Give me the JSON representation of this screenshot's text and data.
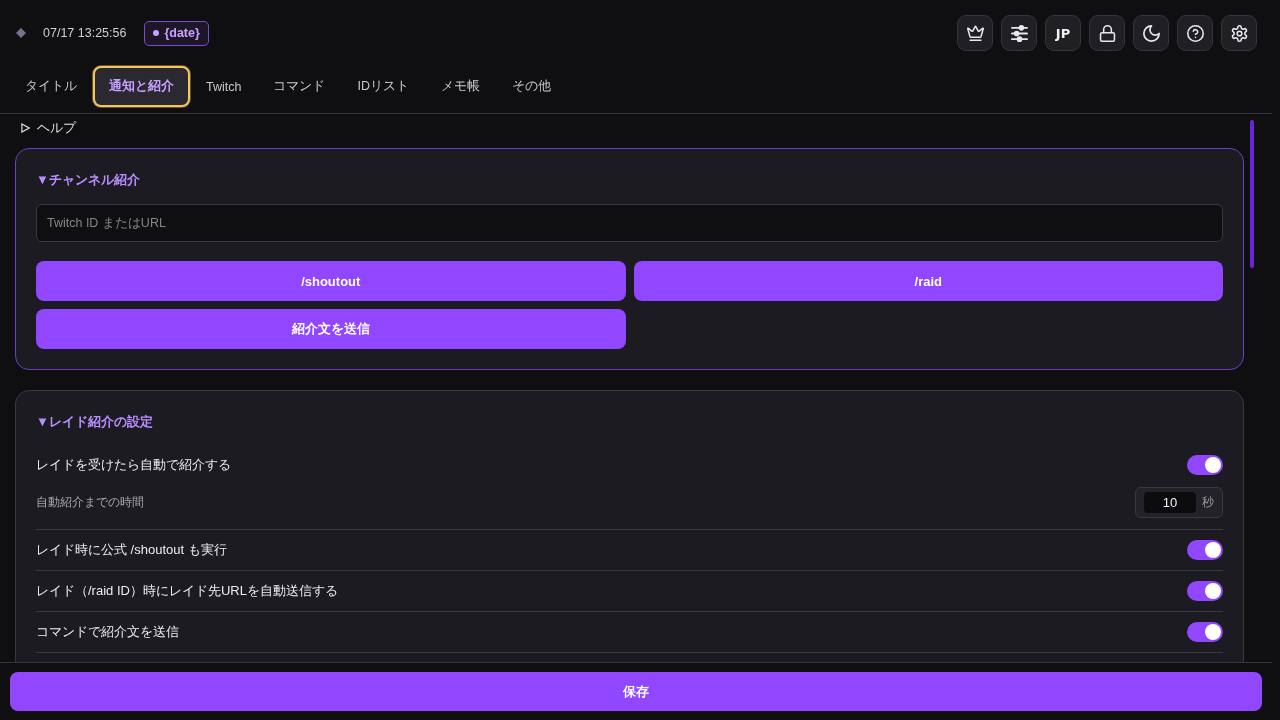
{
  "header": {
    "time": "07/17 13:25:56",
    "badge": {
      "label": "{date}"
    },
    "language_button": {
      "label": "JP"
    }
  },
  "tabs": [
    {
      "label": "タイトル",
      "selected": false
    },
    {
      "label": "通知と紹介",
      "selected": true
    },
    {
      "label": "Twitch",
      "selected": false
    },
    {
      "label": "コマンド",
      "selected": false
    },
    {
      "label": "IDリスト",
      "selected": false
    },
    {
      "label": "メモ帳",
      "selected": false
    },
    {
      "label": "その他",
      "selected": false
    }
  ],
  "help": {
    "label": "ヘルプ",
    "expanded": false
  },
  "channel_intro": {
    "title": "▼チャンネル紹介",
    "input": {
      "placeholder": "Twitch ID またはURL"
    },
    "buttons": [
      "/shoutout",
      "/raid",
      "紹介文を送信"
    ]
  },
  "raid_settings": {
    "title": "▼レイド紹介の設定",
    "rows": [
      {
        "kind": "toggle",
        "label": "レイドを受けたら自動で紹介する",
        "on": true
      },
      {
        "kind": "number",
        "label": "自動紹介までの時間",
        "value": "10",
        "unit": "秒"
      },
      {
        "kind": "toggle",
        "label": "レイド時に公式 /shoutout も実行",
        "on": true
      },
      {
        "kind": "toggle",
        "label": "レイド（/raid ID）時にレイド先URLを自動送信する",
        "on": true
      },
      {
        "kind": "toggle",
        "label": "コマンドで紹介文を送信",
        "on": true
      }
    ]
  },
  "save_button": {
    "label": "保存"
  }
}
